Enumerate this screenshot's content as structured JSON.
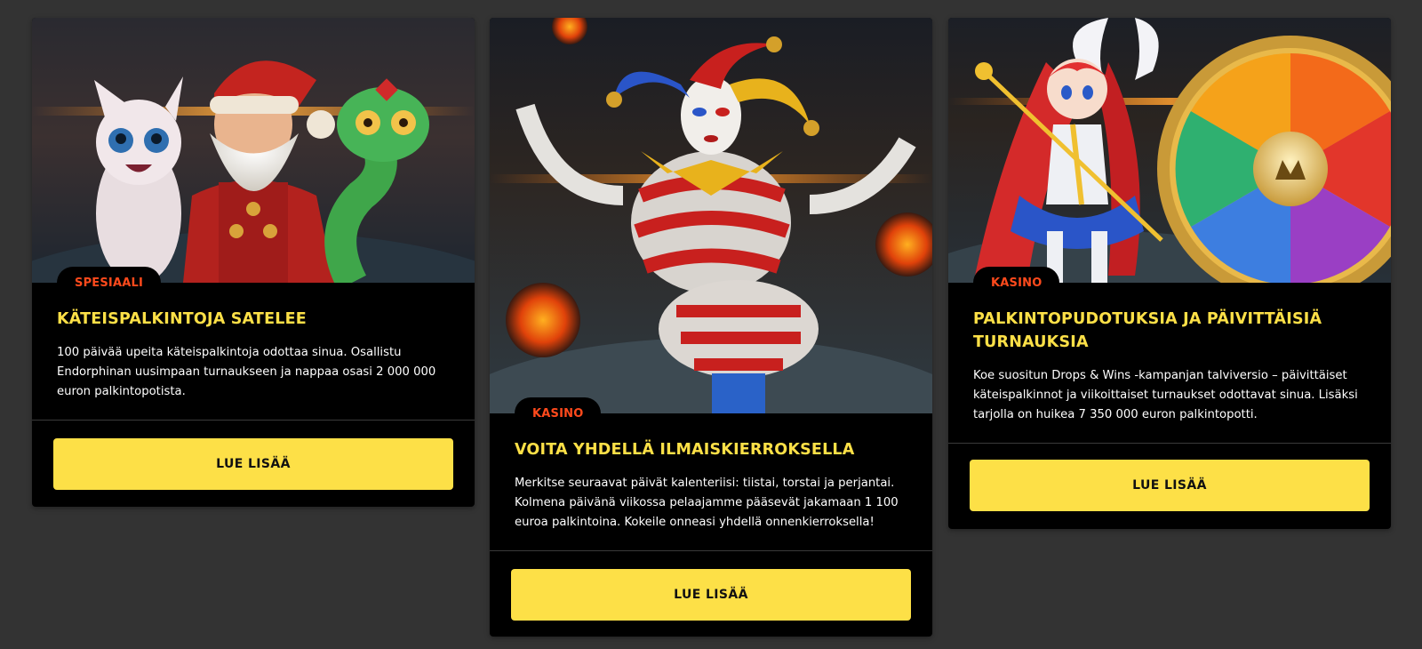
{
  "cards": [
    {
      "badge": "SPESIAALI",
      "title": "KÄTEISPALKINTOJA SATELEE",
      "description": "100 päivää upeita käteispalkintoja odottaa sinua. Osallistu Endorphinan uusimpaan turnaukseen ja nappaa osasi 2 000 000 euron palkintopotista.",
      "button_label": "LUE LISÄÄ",
      "image": "santa-cat-snake-artwork"
    },
    {
      "badge": "KASINO",
      "title": "VOITA YHDELLÄ ILMAISKIERROKSELLA",
      "description": "Merkitse seuraavat päivät kalenteriisi: tiistai, torstai ja perjantai. Kolmena päivänä viikossa pelaajamme pääsevät jakamaan 1 100 euroa palkintoina. Kokeile onneasi yhdellä onnenkierroksella!",
      "button_label": "LUE LISÄÄ",
      "image": "jester-artwork"
    },
    {
      "badge": "KASINO",
      "title": "PALKINTOPUDOTUKSIA JA PÄIVITTÄISIÄ TURNAUKSIA",
      "description": "Koe suositun Drops & Wins -kampanjan talviversio – päivittäiset käteispalkinnot ja viikoittaiset turnaukset odottavat sinua. Lisäksi tarjolla on huikea 7 350 000 euron palkintopotti.",
      "button_label": "LUE LISÄÄ",
      "image": "anime-girl-prize-wheel-artwork"
    }
  ],
  "colors": {
    "page_background": "#333333",
    "card_background": "#000000",
    "title": "#fde047",
    "badge_text": "#ff4a1c",
    "button": "#fde047",
    "button_text": "#111111"
  }
}
